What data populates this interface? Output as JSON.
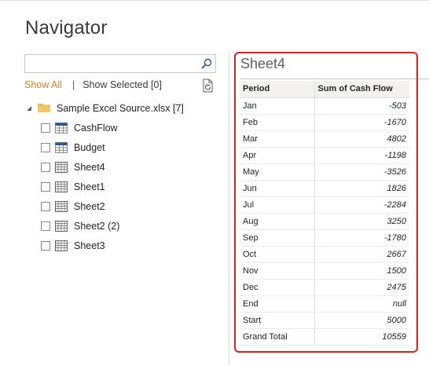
{
  "window": {
    "title": "Navigator"
  },
  "search": {
    "placeholder": "",
    "value": ""
  },
  "filters": {
    "show_all": "Show All",
    "separator": "|",
    "show_selected": "Show Selected [0]"
  },
  "tree": {
    "root": {
      "label": "Sample Excel Source.xlsx [7]"
    },
    "items": [
      {
        "label": "CashFlow",
        "icon": "table-icon"
      },
      {
        "label": "Budget",
        "icon": "table-icon"
      },
      {
        "label": "Sheet4",
        "icon": "sheet-icon"
      },
      {
        "label": "Sheet1",
        "icon": "sheet-icon"
      },
      {
        "label": "Sheet2",
        "icon": "sheet-icon"
      },
      {
        "label": "Sheet2 (2)",
        "icon": "sheet-icon"
      },
      {
        "label": "Sheet3",
        "icon": "sheet-icon"
      }
    ]
  },
  "preview": {
    "title": "Sheet4",
    "columns": [
      "Period",
      "Sum of Cash Flow"
    ],
    "rows": [
      [
        "Jan",
        "-503"
      ],
      [
        "Feb",
        "-1670"
      ],
      [
        "Mar",
        "4802"
      ],
      [
        "Apr",
        "-1198"
      ],
      [
        "May",
        "-3526"
      ],
      [
        "Jun",
        "1826"
      ],
      [
        "Jul",
        "-2284"
      ],
      [
        "Aug",
        "3250"
      ],
      [
        "Sep",
        "-1780"
      ],
      [
        "Oct",
        "2667"
      ],
      [
        "Nov",
        "1500"
      ],
      [
        "Dec",
        "2475"
      ],
      [
        "End",
        "null"
      ],
      [
        "Start",
        "5000"
      ],
      [
        "Grand Total",
        "10559"
      ]
    ]
  },
  "colors": {
    "accent": "#c8862e",
    "highlight": "#e02020",
    "table_icon_blue": "#2b579a"
  }
}
